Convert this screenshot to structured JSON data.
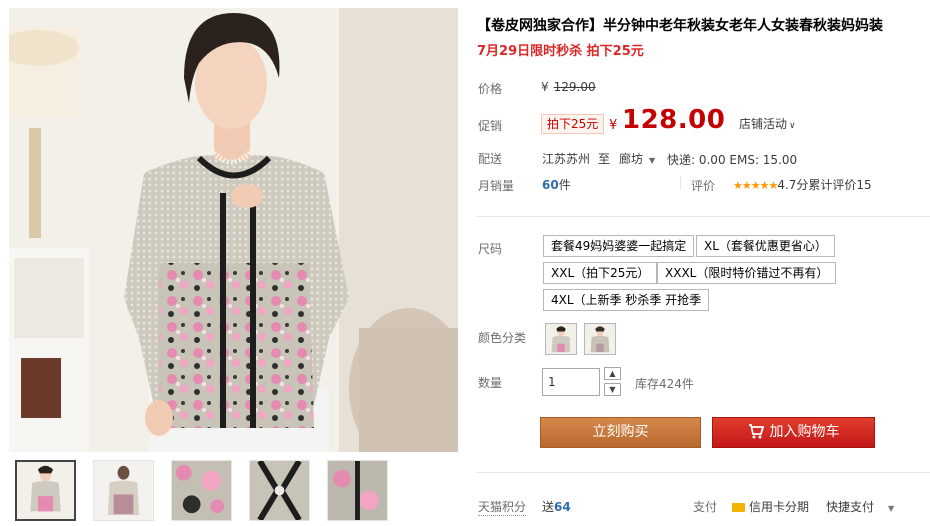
{
  "product": {
    "title": "【卷皮网独家合作】半分钟中老年秋装女老年人女装春秋装妈妈装",
    "subtitle": "7月29日限时秒杀 拍下25元"
  },
  "price": {
    "label": "价格",
    "yen": "¥",
    "original": "129.00"
  },
  "promo": {
    "label": "促销",
    "tag": "拍下25元",
    "yen": "¥",
    "price": "128.00",
    "shop_activity": "店铺活动"
  },
  "shipping": {
    "label": "配送",
    "from": "江苏苏州",
    "to_word": "至",
    "to": "廊坊",
    "cost": "快递: 0.00 EMS: 15.00"
  },
  "sales": {
    "label": "月销量",
    "count": "60",
    "unit": "件",
    "rating_label": "评价",
    "stars": "★★★★★",
    "score": "4.7分",
    "reviews": "累计评价15"
  },
  "size": {
    "label": "尺码",
    "options": [
      "套餐49妈妈婆婆一起搞定",
      "XL（套餐优惠更省心）",
      "XXL（拍下25元）",
      "XXXL（限时特价错过不再有）",
      "4XL（上新季 秒杀季 开抢季"
    ]
  },
  "color": {
    "label": "颜色分类"
  },
  "quantity": {
    "label": "数量",
    "value": "1",
    "up": "▲",
    "down": "▼",
    "stock": "库存424件"
  },
  "actions": {
    "buy_now": "立刻购买",
    "add_to_cart": "加入购物车"
  },
  "footer": {
    "points_label": "天猫积分",
    "points_prefix": "送",
    "points_value": "64",
    "pay_label": "支付",
    "credit": "信用卡分期",
    "quick_pay": "快捷支付"
  },
  "colors": {
    "accent_red": "#c40000",
    "buy_orange": "#c8793b",
    "cart_red": "#d12a20",
    "star_orange": "#ff9900"
  }
}
